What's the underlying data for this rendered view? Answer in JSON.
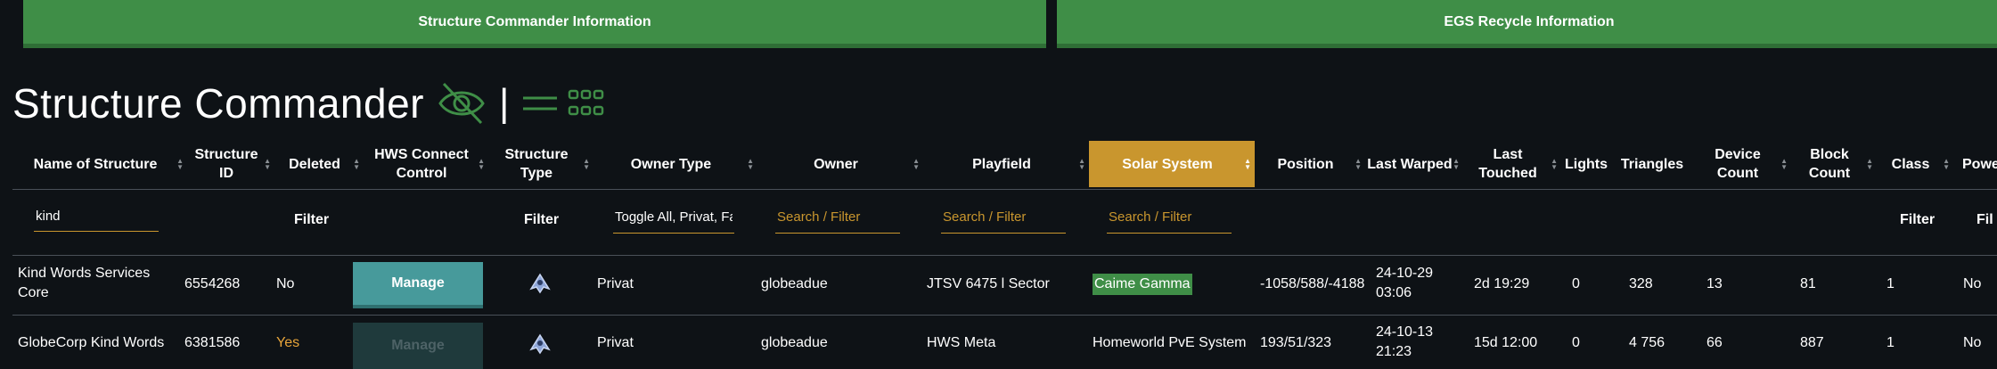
{
  "topbar": {
    "left_label": "Structure Commander Information",
    "right_label": "EGS Recycle Information"
  },
  "page": {
    "title": "Structure Commander",
    "separator": "|"
  },
  "columns": [
    {
      "key": "name",
      "label": "Name of Structure"
    },
    {
      "key": "id",
      "label": "Structure ID"
    },
    {
      "key": "deleted",
      "label": "Deleted"
    },
    {
      "key": "hws",
      "label": "HWS Connect Control"
    },
    {
      "key": "type",
      "label": "Structure Type"
    },
    {
      "key": "owner_type",
      "label": "Owner Type"
    },
    {
      "key": "owner",
      "label": "Owner"
    },
    {
      "key": "playfield",
      "label": "Playfield"
    },
    {
      "key": "solar",
      "label": "Solar System",
      "active": true
    },
    {
      "key": "position",
      "label": "Position"
    },
    {
      "key": "last_warped",
      "label": "Last Warped"
    },
    {
      "key": "last_touched",
      "label": "Last Touched"
    },
    {
      "key": "lights",
      "label": "Lights"
    },
    {
      "key": "triangles",
      "label": "Triangles"
    },
    {
      "key": "device_count",
      "label": "Device Count"
    },
    {
      "key": "block_count",
      "label": "Block Count"
    },
    {
      "key": "class",
      "label": "Class"
    },
    {
      "key": "power",
      "label": "Powe"
    }
  ],
  "filters": {
    "name_value": "kind",
    "deleted_label": "Filter",
    "type_label": "Filter",
    "owner_type_value": "Toggle All, Privat, Fa",
    "owner_placeholder": "Search / Filter",
    "playfield_placeholder": "Search / Filter",
    "solar_placeholder": "Search / Filter",
    "class_label": "Filter",
    "power_label": "Fil"
  },
  "rows": [
    {
      "name": "Kind Words Services Core",
      "id": "6554268",
      "deleted": "No",
      "manage": "Manage",
      "owner_type": "Privat",
      "owner": "globeadue",
      "playfield": "JTSV 6475 l Sector",
      "solar": "Caime Gamma",
      "position": "-1058/588/-4188",
      "last_warped": "24-10-29 03:06",
      "last_touched": "2d 19:29",
      "lights": "0",
      "triangles": "328",
      "device_count": "13",
      "block_count": "81",
      "class": "1",
      "power": "No"
    },
    {
      "name": "GlobeCorp Kind Words",
      "id": "6381586",
      "deleted": "Yes",
      "manage": "Manage",
      "owner_type": "Privat",
      "owner": "globeadue",
      "playfield": "HWS Meta",
      "solar": "Homeworld PvE System",
      "position": "193/51/323",
      "last_warped": "24-10-13 21:23",
      "last_touched": "15d 12:00",
      "lights": "0",
      "triangles": "4 756",
      "device_count": "66",
      "block_count": "887",
      "class": "1",
      "power": "No"
    }
  ],
  "colors": {
    "green": "#3f8e47",
    "gold": "#c9962e",
    "teal": "#479a9b",
    "bg": "#0e1216"
  },
  "icons": {
    "visibility": "eye-off-icon",
    "list_view": "list-view-icon",
    "grid_view": "grid-view-icon",
    "structure_type": "spaceship-icon"
  }
}
